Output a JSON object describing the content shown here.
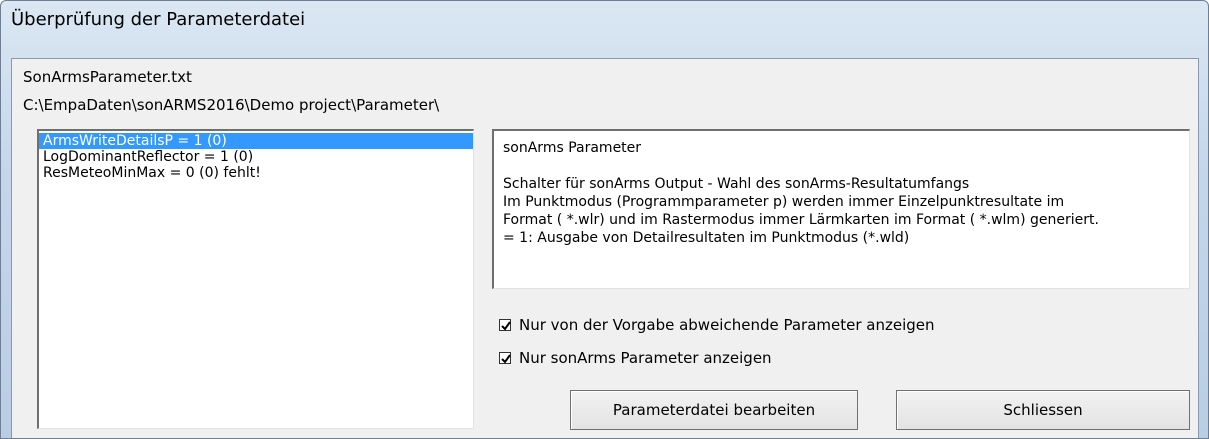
{
  "window": {
    "title": "Überprüfung der Parameterdatei"
  },
  "file": {
    "name": "SonArmsParameter.txt",
    "path": "C:\\EmpaDaten\\sonARMS2016\\Demo project\\Parameter\\"
  },
  "parameter_list": [
    {
      "label": "ArmsWriteDetailsP = 1 (0)",
      "selected": true
    },
    {
      "label": "LogDominantReflector = 1 (0)",
      "selected": false
    },
    {
      "label": "ResMeteoMinMax = 0 (0) fehlt!",
      "selected": false
    }
  ],
  "info": {
    "heading": "sonArms Parameter",
    "lines": [
      "Schalter für sonArms Output - Wahl des sonArms-Resultatumfangs",
      "Im Punktmodus (Programmparameter p) werden immer Einzelpunktresultate im",
      "Format ( *.wlr) und im Rastermodus immer Lärmkarten im Format ( *.wlm) generiert.",
      "= 1: Ausgabe von Detailresultaten im Punktmodus (*.wld)"
    ]
  },
  "options": {
    "only_deviating": {
      "label": "Nur von der Vorgabe abweichende Parameter anzeigen",
      "checked": true
    },
    "only_sonarms": {
      "label": "Nur sonArms Parameter anzeigen",
      "checked": true
    }
  },
  "buttons": {
    "edit": "Parameterdatei bearbeiten",
    "close": "Schliessen"
  }
}
